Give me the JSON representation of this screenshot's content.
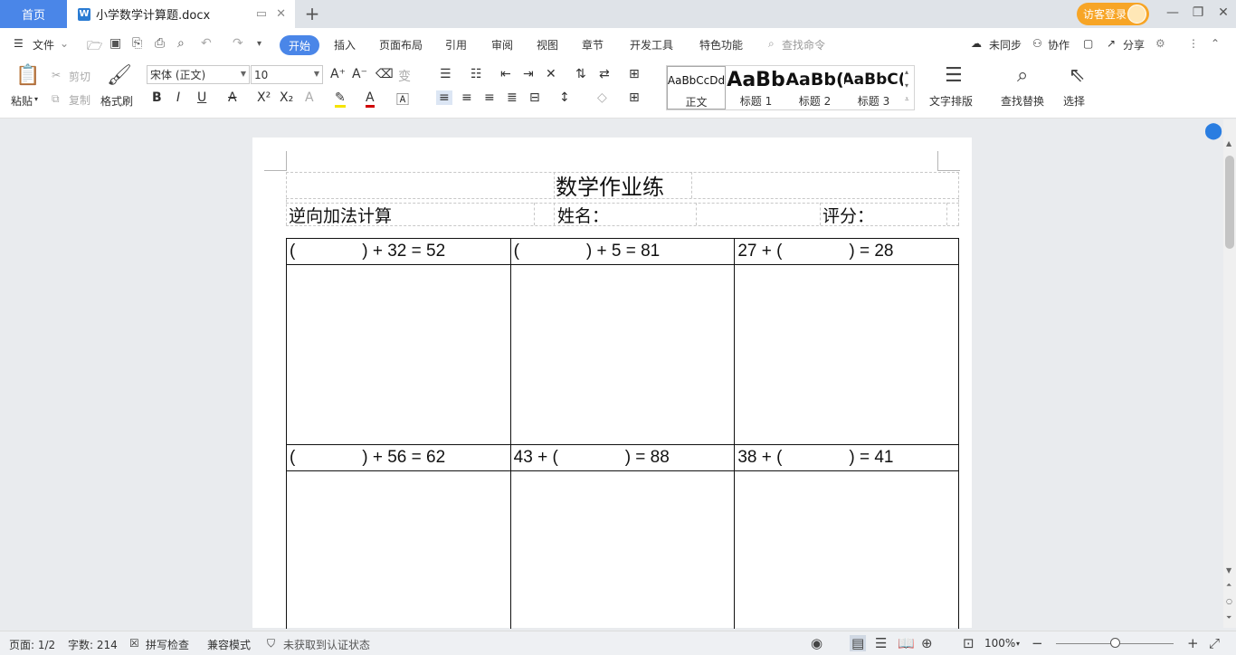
{
  "titlebar": {
    "home_tab": "首页",
    "doc_tab": "小学数学计算题.docx",
    "login": "访客登录"
  },
  "menu": {
    "file": "文件",
    "tabs": [
      "开始",
      "插入",
      "页面布局",
      "引用",
      "审阅",
      "视图",
      "章节",
      "开发工具",
      "特色功能"
    ],
    "search": "查找命令",
    "sync": "未同步",
    "collab": "协作",
    "share": "分享"
  },
  "ribbon": {
    "paste": "粘贴",
    "cut": "剪切",
    "copy": "复制",
    "format_painter": "格式刷",
    "font_name": "宋体 (正文)",
    "font_size": "10",
    "styles": [
      {
        "sample": "AaBbCcDd",
        "label": "正文"
      },
      {
        "sample": "AaBb",
        "label": "标题 1"
      },
      {
        "sample": "AaBb(",
        "label": "标题 2"
      },
      {
        "sample": "AaBbC(",
        "label": "标题 3"
      }
    ],
    "text_layout": "文字排版",
    "find_replace": "查找替换",
    "select": "选择"
  },
  "document": {
    "title": "数学作业练",
    "subject": "逆向加法计算",
    "name_label": "姓名：",
    "score_label": "评分：",
    "problems": [
      [
        "(              ) + 32 = 52",
        "(              ) + 5 = 81",
        "27 + (              ) = 28"
      ],
      [
        "(              ) + 56 = 62",
        "43 + (              ) = 88",
        "38 + (              ) = 41"
      ]
    ]
  },
  "status": {
    "page": "页面: 1/2",
    "words": "字数: 214",
    "spell": "拼写检查",
    "compat": "兼容模式",
    "auth": "未获取到认证状态",
    "zoom": "100%"
  },
  "colors": {
    "accent": "#4a86e8",
    "login": "#f7a526"
  }
}
